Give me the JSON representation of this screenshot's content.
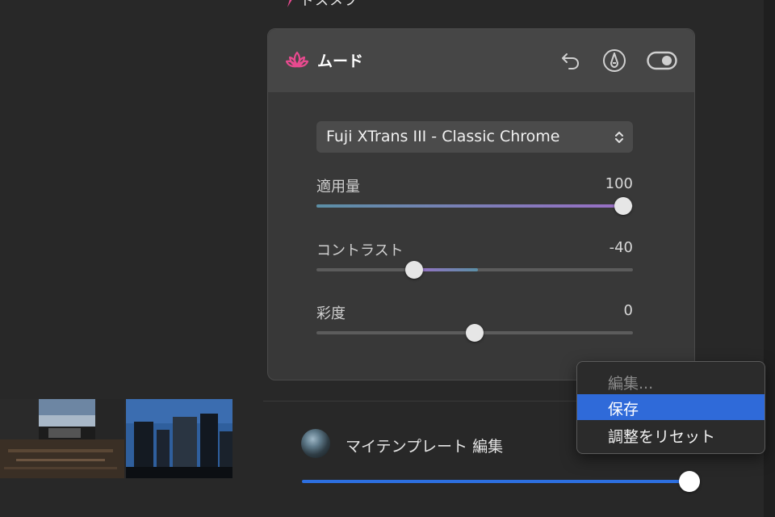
{
  "section": {
    "title_fragment": "ドスメブ"
  },
  "panel": {
    "title": "ムード",
    "icons": [
      "lotus-icon",
      "undo-icon",
      "brush-icon",
      "eye-toggle-icon"
    ],
    "preset": {
      "value": "Fuji XTrans III - Classic Chrome"
    },
    "sliders": [
      {
        "label": "適用量",
        "value": "100",
        "level": 1.0
      },
      {
        "label": "コントラスト",
        "value": "-40",
        "level": 0.3
      },
      {
        "label": "彩度",
        "value": "0",
        "level": 0.5
      }
    ]
  },
  "templates": {
    "label": "マイテンプレート 編集",
    "level": 0.97
  },
  "context_menu": {
    "items": [
      {
        "label": "編集...",
        "state": "disabled"
      },
      {
        "label": "保存",
        "state": "highlighted"
      },
      {
        "label": "調整をリセット",
        "state": "normal"
      }
    ]
  },
  "colors": {
    "background": "#282828",
    "panel": "#383838",
    "panel_header": "#464646",
    "accent_pink": "#e84a8f",
    "accent_blue": "#2f6ad9",
    "slider_gradient_start": "#5b8fa6",
    "slider_gradient_end": "#9a6fc6"
  }
}
